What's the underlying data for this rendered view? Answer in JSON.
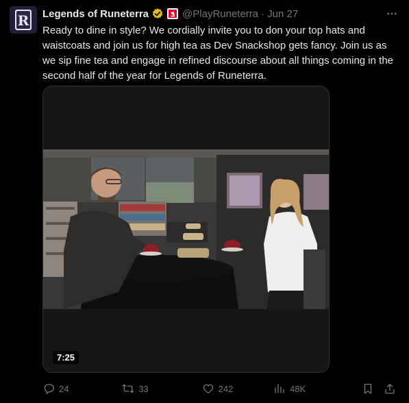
{
  "tweet": {
    "author_name": "Legends of Runeterra",
    "handle": "@PlayRuneterra",
    "separator": "·",
    "date": "Jun 27",
    "avatar_letter": "R",
    "text": "Ready to dine in style? We cordially invite you to don your top hats and waistcoats and join us for high tea as Dev Snackshop gets fancy. Join us as we sip fine tea and engage in refined discourse about all things coming in the second half of the year for Legends of Runeterra.",
    "media": {
      "duration": "7:25"
    },
    "stats": {
      "replies": "24",
      "reposts": "33",
      "likes": "242",
      "views": "48K"
    }
  },
  "icons": {
    "verified": "gold-verified-badge-icon",
    "affiliate": "riot-affiliate-badge-icon",
    "more": "more-options-icon",
    "reply": "reply-icon",
    "repost": "repost-icon",
    "like": "heart-icon",
    "views": "views-chart-icon",
    "bookmark": "bookmark-icon",
    "share": "share-icon"
  },
  "colors": {
    "background": "#000000",
    "text": "#e7e9ea",
    "muted": "#71767b",
    "gold": "#e2b719",
    "affiliate_red": "#eb0029"
  }
}
